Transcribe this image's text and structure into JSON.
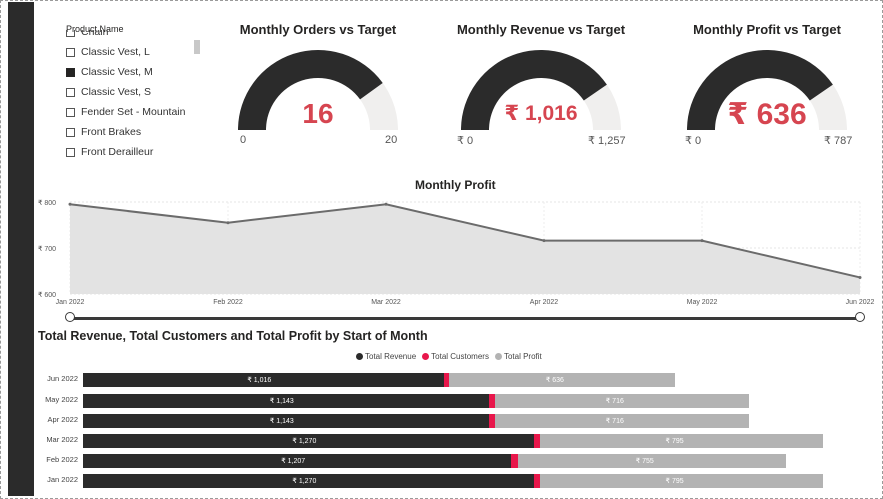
{
  "slicer": {
    "title": "Product Name",
    "items": [
      {
        "label": "Chain",
        "checked": false
      },
      {
        "label": "Classic Vest, L",
        "checked": false
      },
      {
        "label": "Classic Vest, M",
        "checked": true
      },
      {
        "label": "Classic Vest, S",
        "checked": false
      },
      {
        "label": "Fender Set - Mountain",
        "checked": false
      },
      {
        "label": "Front Brakes",
        "checked": false
      },
      {
        "label": "Front Derailleur",
        "checked": false
      }
    ]
  },
  "gauges": [
    {
      "title": "Monthly Orders vs Target",
      "value_text": "16",
      "min": "0",
      "max": "20",
      "fill_fraction": 0.8
    },
    {
      "title": "Monthly Revenue vs Target",
      "value_text": "₹ 1,016",
      "min": "₹ 0",
      "max": "₹ 1,257",
      "fill_fraction": 0.808
    },
    {
      "title": "Monthly Profit vs Target",
      "value_text": "₹ 636",
      "min": "₹ 0",
      "max": "₹ 787",
      "fill_fraction": 0.808
    }
  ],
  "colors": {
    "dark": "#2b2b2b",
    "accent": "#d64550",
    "pink": "#e8174b",
    "gray": "#b3b3b3",
    "track": "#f0efee"
  },
  "chart_data": [
    {
      "type": "area",
      "title": "Monthly Profit",
      "x": [
        "Jan 2022",
        "Feb 2022",
        "Mar 2022",
        "Apr 2022",
        "May 2022",
        "Jun 2022"
      ],
      "y_ticks": [
        "₹ 800",
        "₹ 700",
        "₹ 600"
      ],
      "ylim": [
        600,
        800
      ],
      "series": [
        {
          "name": "",
          "values": [
            795,
            755,
            795,
            716,
            716,
            636
          ]
        }
      ]
    },
    {
      "type": "bar",
      "title": "Total Revenue, Total Customers and Total Profit by Start of Month",
      "categories": [
        "Jun 2022",
        "May 2022",
        "Apr 2022",
        "Mar 2022",
        "Feb 2022",
        "Jan 2022"
      ],
      "series": [
        {
          "name": "Total Revenue",
          "values": [
            1016,
            1143,
            1143,
            1270,
            1207,
            1270
          ],
          "labels": [
            "₹ 1,016",
            "₹ 1,143",
            "₹ 1,143",
            "₹ 1,270",
            "₹ 1,207",
            "₹ 1,270"
          ]
        },
        {
          "name": "Total Customers",
          "values": [
            16,
            18,
            18,
            20,
            19,
            20
          ]
        },
        {
          "name": "Total Profit",
          "values": [
            636,
            716,
            716,
            795,
            755,
            795
          ],
          "labels": [
            "₹ 636",
            "₹ 716",
            "₹ 716",
            "₹ 795",
            "₹ 755",
            "₹ 795"
          ]
        }
      ]
    }
  ]
}
